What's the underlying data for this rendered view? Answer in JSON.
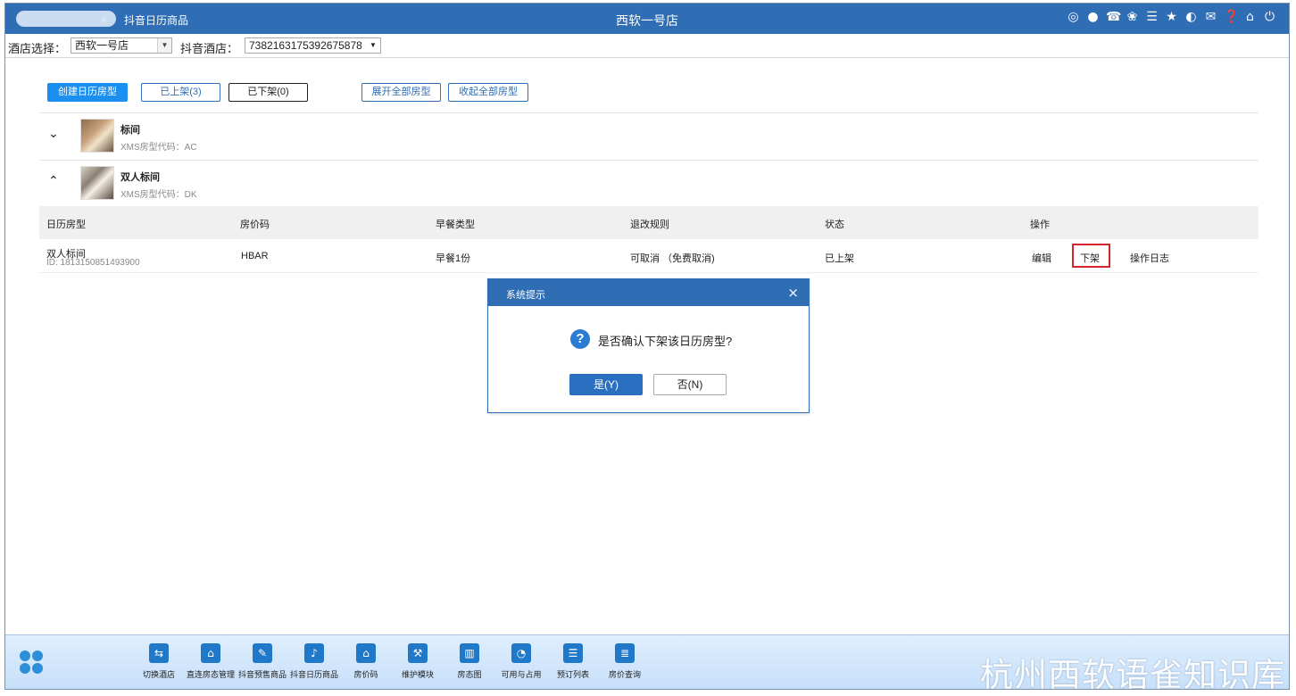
{
  "titlebar": {
    "app_name": "抖音日历商品",
    "window_title": "西软一号店",
    "icons": [
      "wifi-icon",
      "minimize-icon",
      "phone-icon",
      "palette-icon",
      "menu-icon",
      "star-icon",
      "contrast-icon",
      "mail-icon",
      "help-icon",
      "home-icon",
      "power-icon"
    ]
  },
  "selector": {
    "hotel_label": "酒店选择：",
    "hotel_value": "西软一号店",
    "douyin_label": "抖音酒店：",
    "douyin_value": "7382163175392675878"
  },
  "toolbar": {
    "create_label": "创建日历房型",
    "listed_label": "已上架(3)",
    "unlisted_label": "已下架(0)",
    "expand_label": "展开全部房型",
    "collapse_label": "收起全部房型"
  },
  "groups": [
    {
      "name": "标间",
      "code": "XMS房型代码：AC",
      "chevron": "⌄"
    },
    {
      "name": "双人标间",
      "code": "XMS房型代码：DK",
      "chevron": "⌃"
    }
  ],
  "table": {
    "headers": [
      "日历房型",
      "房价码",
      "早餐类型",
      "退改规则",
      "状态",
      "操作"
    ],
    "rows": [
      {
        "room": "双人标间",
        "id": "ID: 1813150851493900",
        "rate_code": "HBAR",
        "breakfast": "早餐1份",
        "policy": "可取消 （免费取消)",
        "status": "已上架",
        "actions": {
          "edit": "编辑",
          "unlist": "下架",
          "log": "操作日志"
        }
      }
    ]
  },
  "dialog": {
    "title": "系统提示",
    "close": "×",
    "message": "是否确认下架该日历房型?",
    "yes": "是(Y)",
    "no": "否(N)"
  },
  "bottombar": {
    "dock": [
      {
        "label": "切换酒店",
        "icon": "⇆"
      },
      {
        "label": "直连房态管理",
        "icon": "⌂"
      },
      {
        "label": "抖音预售商品",
        "icon": "✎"
      },
      {
        "label": "抖音日历商品",
        "icon": "♪"
      },
      {
        "label": "房价码",
        "icon": "⌂"
      },
      {
        "label": "维护模块",
        "icon": "⚒"
      },
      {
        "label": "房态图",
        "icon": "▥"
      },
      {
        "label": "可用与占用",
        "icon": "◔"
      },
      {
        "label": "预订列表",
        "icon": "☰"
      },
      {
        "label": "房价查询",
        "icon": "≣"
      }
    ],
    "watermark": "杭州西软语雀知识库"
  }
}
